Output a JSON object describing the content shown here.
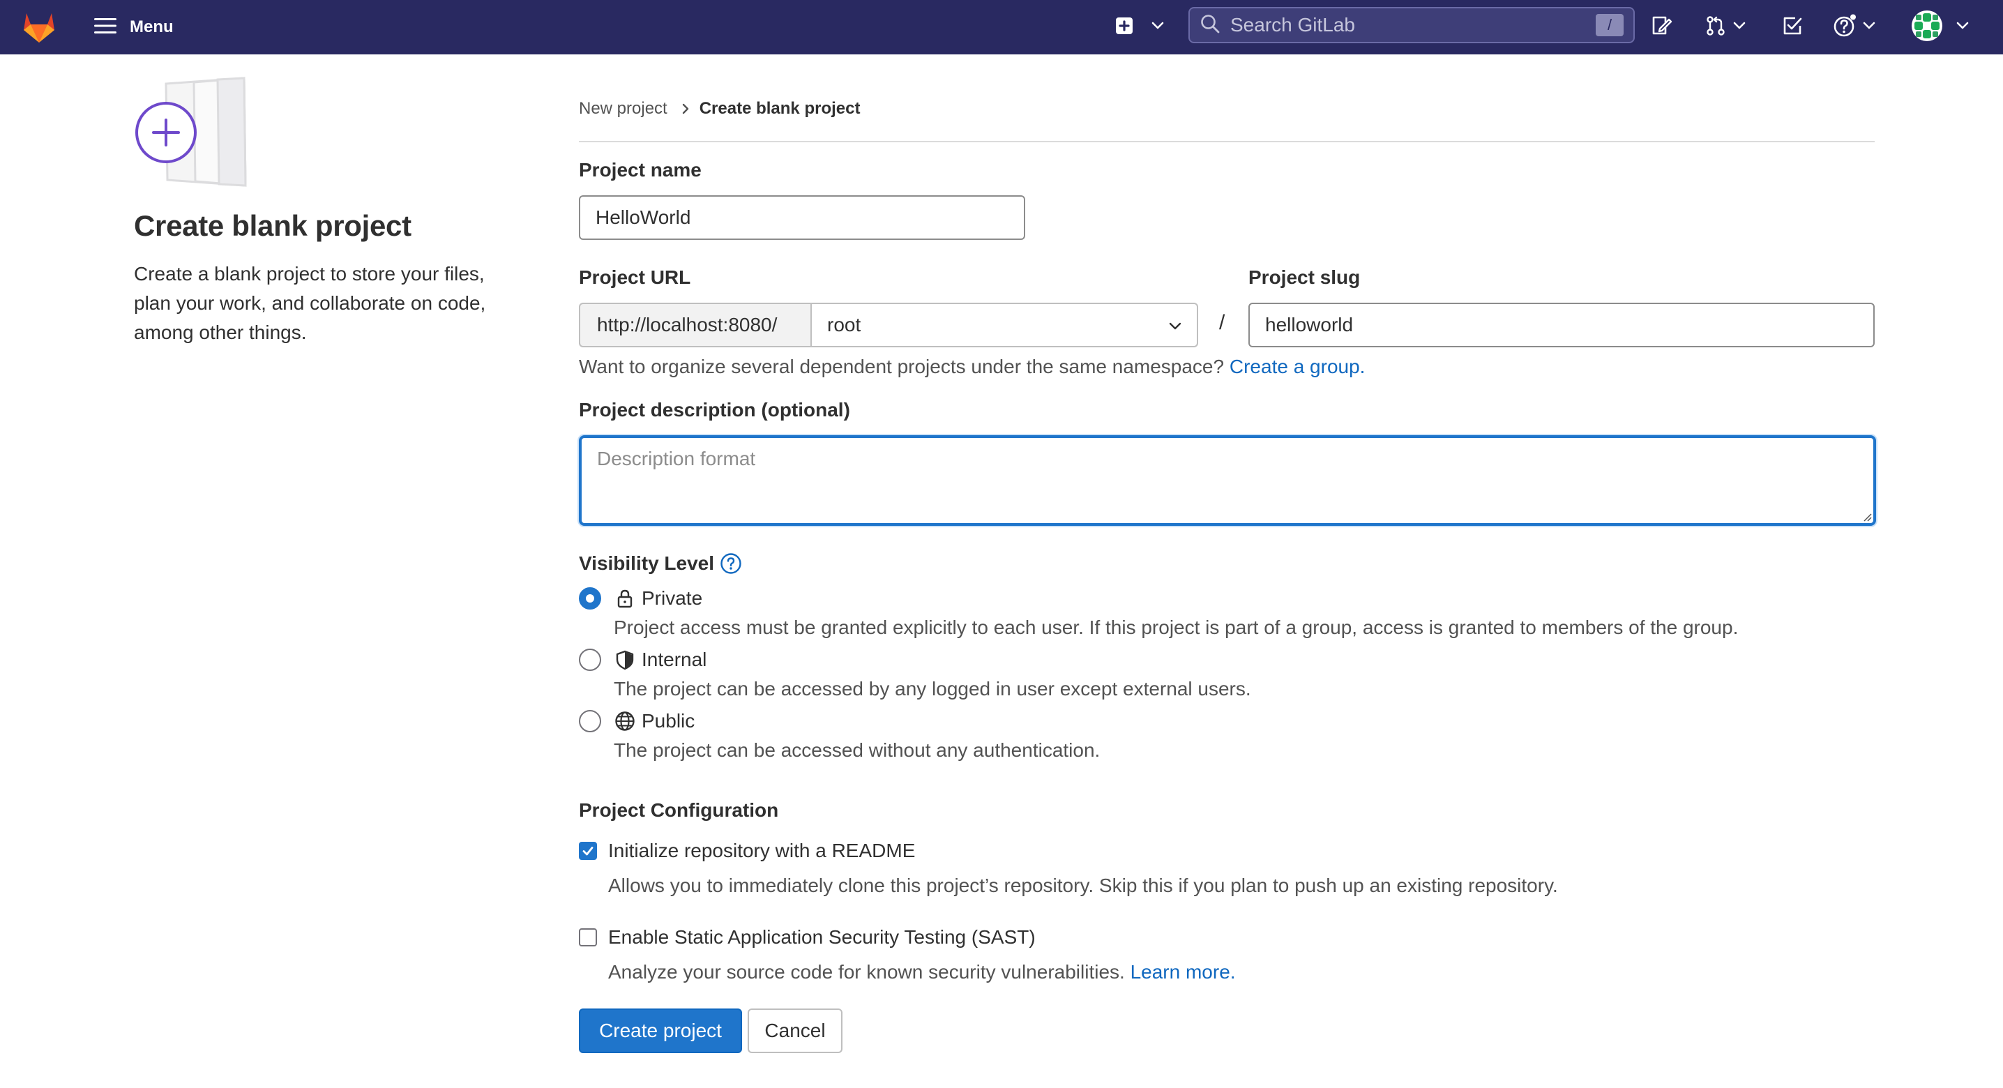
{
  "header": {
    "menu_label": "Menu",
    "search_placeholder": "Search GitLab",
    "search_shortcut": "/",
    "icons": [
      "gitlab-logo",
      "hamburger-icon",
      "plus-square-icon",
      "chevron-down-icon",
      "search-icon",
      "issues-icon",
      "merge-request-icon",
      "todo-icon",
      "help-icon",
      "avatar"
    ]
  },
  "left": {
    "title": "Create blank project",
    "description": "Create a blank project to store your files, plan your work, and collaborate on code, among other things."
  },
  "breadcrumb": {
    "parent": "New project",
    "current": "Create blank project"
  },
  "form": {
    "project_name_label": "Project name",
    "project_name_value": "HelloWorld",
    "project_url_label": "Project URL",
    "url_prefix": "http://localhost:8080/",
    "namespace_value": "root",
    "slash": "/",
    "project_slug_label": "Project slug",
    "project_slug_value": "helloworld",
    "namespace_hint": "Want to organize several dependent projects under the same namespace?",
    "create_group_link": "Create a group.",
    "description_label": "Project description (optional)",
    "description_placeholder": "Description format",
    "visibility_label": "Visibility Level",
    "visibility_options": [
      {
        "label": "Private",
        "help": "Project access must be granted explicitly to each user. If this project is part of a group, access is granted to members of the group.",
        "checked": true,
        "icon": "lock-icon"
      },
      {
        "label": "Internal",
        "help": "The project can be accessed by any logged in user except external users.",
        "checked": false,
        "icon": "shield-icon"
      },
      {
        "label": "Public",
        "help": "The project can be accessed without any authentication.",
        "checked": false,
        "icon": "globe-icon"
      }
    ],
    "config_label": "Project Configuration",
    "readme_label": "Initialize repository with a README",
    "readme_help": "Allows you to immediately clone this project’s repository. Skip this if you plan to push up an existing repository.",
    "readme_checked": true,
    "sast_label": "Enable Static Application Security Testing (SAST)",
    "sast_help": "Analyze your source code for known security vulnerabilities.",
    "sast_learn_more": "Learn more.",
    "sast_checked": false,
    "create_button": "Create project",
    "cancel_button": "Cancel"
  },
  "colors": {
    "navbar": "#292961",
    "primary": "#1f75cb",
    "link": "#1068bf",
    "accent_purple": "#6e49cb"
  }
}
